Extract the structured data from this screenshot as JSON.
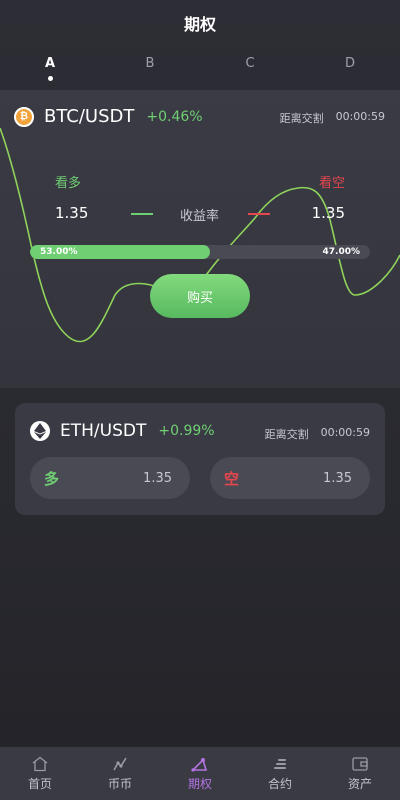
{
  "header": {
    "title": "期权"
  },
  "tabs": [
    {
      "label": "A",
      "active": true
    },
    {
      "label": "B",
      "active": false
    },
    {
      "label": "C",
      "active": false
    },
    {
      "label": "D",
      "active": false
    }
  ],
  "btc": {
    "icon": "bitcoin-icon",
    "pair": "BTC/USDT",
    "change": "+0.46%",
    "settle_label": "距离交割",
    "countdown": "00:00:59",
    "bull_label": "看多",
    "bear_label": "看空",
    "bull_rate": "1.35",
    "bear_rate": "1.35",
    "yield_label": "收益率",
    "bull_ratio_text": "53.00%",
    "bear_ratio_text": "47.00%",
    "bull_ratio": 0.53,
    "buy_label": "购买"
  },
  "eth": {
    "icon": "ethereum-icon",
    "pair": "ETH/USDT",
    "change": "+0.99%",
    "settle_label": "距离交割",
    "countdown": "00:00:59",
    "long_label": "多",
    "long_value": "1.35",
    "short_label": "空",
    "short_value": "1.35"
  },
  "nav": [
    {
      "label": "首页",
      "icon": "home-icon",
      "active": false
    },
    {
      "label": "币币",
      "icon": "coin-trade-icon",
      "active": false
    },
    {
      "label": "期权",
      "icon": "options-icon",
      "active": true
    },
    {
      "label": "合约",
      "icon": "contract-icon",
      "active": false
    },
    {
      "label": "资产",
      "icon": "wallet-icon",
      "active": false
    }
  ],
  "colors": {
    "up": "#6fcf72",
    "down": "#e4474d",
    "accent": "#b473e3",
    "background": "#2d2d35",
    "panel": "#3a3a44"
  }
}
